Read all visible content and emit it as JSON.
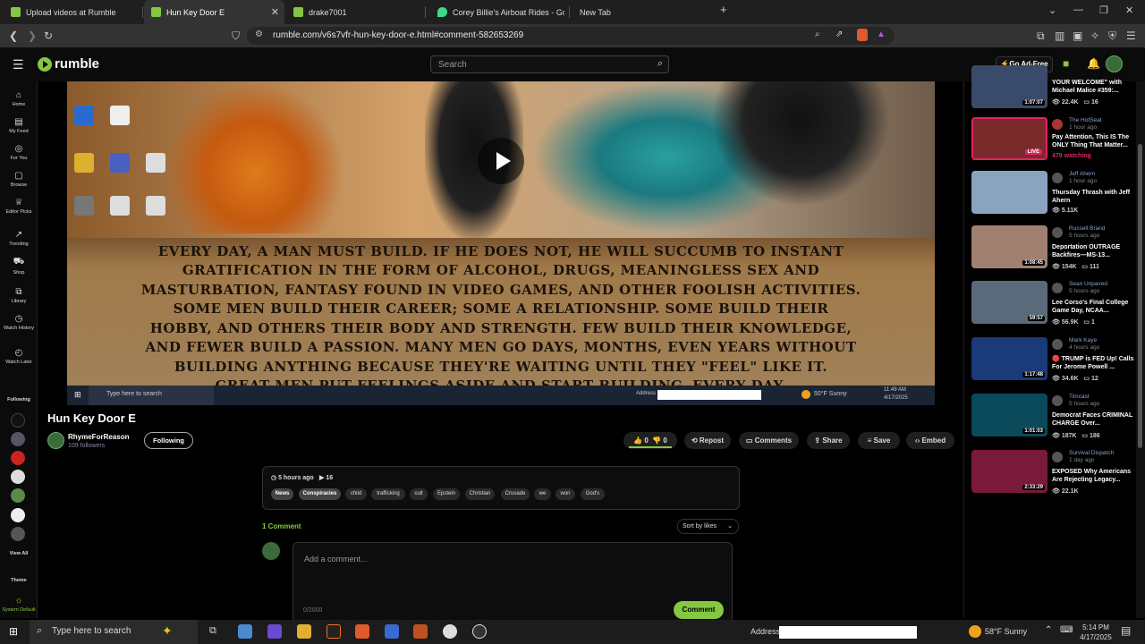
{
  "browser": {
    "tabs": [
      {
        "label": "Upload videos at Rumble",
        "color": "#85c742"
      },
      {
        "label": "Hun Key Door E",
        "color": "#85c742"
      },
      {
        "label": "drake7001",
        "color": "#85c742"
      },
      {
        "label": "Corey Billie's Airboat Rides - Googl",
        "color": "#3ddc84"
      },
      {
        "label": "New Tab",
        "color": ""
      }
    ],
    "url": "rumble.com/v6s7vfr-hun-key-door-e.html#comment-582653269"
  },
  "header": {
    "logo_text": "rumble",
    "search_placeholder": "Search",
    "go_ad_free": "Go Ad-Free"
  },
  "left_nav": {
    "items": [
      "Home",
      "My Feed",
      "For You",
      "Browse",
      "Editor Picks",
      "Trending",
      "Shop",
      "Library",
      "Watch History",
      "Watch Later"
    ],
    "following_label": "Following",
    "view_all": "View All",
    "theme_label": "Theme",
    "theme_value": "System Default"
  },
  "video": {
    "overlay_lines": [
      "EVERY DAY, A MAN MUST BUILD. IF HE DOES NOT, HE WILL SUCCUMB TO INSTANT",
      "GRATIFICATION IN THE FORM OF ALCOHOL, DRUGS, MEANINGLESS SEX AND",
      "MASTURBATION, FANTASY FOUND IN VIDEO GAMES, AND OTHER FOOLISH ACTIVITIES.",
      "SOME MEN BUILD THEIR CAREER; SOME A RELATIONSHIP. SOME BUILD THEIR",
      "HOBBY, AND OTHERS THEIR BODY AND STRENGTH. FEW BUILD THEIR KNOWLEDGE,",
      "AND FEWER BUILD A PASSION. MANY MEN GO DAYS, MONTHS, EVEN YEARS WITHOUT",
      "BUILDING ANYTHING BECAUSE THEY'RE WAITING UNTIL THEY \"FEEL\" LIKE IT.",
      "GREAT MEN PUT FEELINGS ASIDE AND START BUILDING. EVERY DAY."
    ],
    "inner_taskbar_search": "Type here to search",
    "inner_address_label": "Address",
    "inner_weather": "50°F  Sunny",
    "inner_time": "11:49 AM",
    "inner_date": "4/17/2025"
  },
  "details": {
    "title": "Hun Key Door E",
    "channel_name": "RhymeForReason",
    "followers": "109 followers",
    "following_btn": "Following",
    "likes": "0",
    "dislikes": "0",
    "repost": "Repost",
    "comments": "Comments",
    "share": "Share",
    "save": "Save",
    "embed": "Embed",
    "posted": "5 hours ago",
    "views": "16",
    "tags": [
      "News",
      "Conspiracies",
      "child",
      "trafficking",
      "cult",
      "Epstein",
      "Christian",
      "Crusade",
      "we",
      "won",
      "God's"
    ]
  },
  "comments": {
    "count_label": "1 Comment",
    "sort_label": "Sort by likes",
    "placeholder": "Add a comment...",
    "char_count": "0/2000",
    "submit": "Comment"
  },
  "sidebar": {
    "top_partial": {
      "title": "YOUR WELCOME\" with Michael Malice #359:...",
      "duration": "1:07:07",
      "views": "22.4K",
      "comments": "16"
    },
    "videos": [
      {
        "author": "The HotSeat",
        "time": "1 hour ago",
        "title": "Pay Attention, This IS The ONLY Thing That Matter...",
        "stats": "479 watching",
        "live": true,
        "thumb": "#7a2a2a"
      },
      {
        "author": "Jeff Ahern",
        "time": "1 hour ago",
        "title": "Thursday Thrash with Jeff Ahern",
        "stats": "5.11K",
        "comments": "",
        "duration": "",
        "thumb": "#8aa4c0"
      },
      {
        "author": "Russell Brand",
        "time": "5 hours ago",
        "title": "Deportation OUTRAGE Backfires—MS-13...",
        "stats": "154K",
        "comments": "111",
        "duration": "1:08:45",
        "thumb": "#a08070"
      },
      {
        "author": "Sean Unpaved",
        "time": "5 hours ago",
        "title": "Lee Corso's Final College Game Day, NCAA...",
        "stats": "56.9K",
        "comments": "1",
        "duration": "59:57",
        "thumb": "#5a6a7a"
      },
      {
        "author": "Mark Kaye",
        "time": "4 hours ago",
        "title": "🔴 TRUMP is FED Up! Calls For Jerome Powell ...",
        "stats": "34.6K",
        "comments": "12",
        "duration": "1:17:48",
        "thumb": "#1a3a7a"
      },
      {
        "author": "Timcast",
        "time": "5 hours ago",
        "title": "Democrat Faces CRIMINAL CHARGE Over...",
        "stats": "187K",
        "comments": "186",
        "duration": "1:01:03",
        "thumb": "#0a4a5a"
      },
      {
        "author": "Survival Dispatch",
        "time": "1 day ago",
        "title": "EXPOSED Why Americans Are Rejecting Legacy...",
        "stats": "22.1K",
        "comments": "",
        "duration": "2:33:29",
        "thumb": "#7a1a3a"
      }
    ]
  },
  "taskbar": {
    "search": "Type here to search",
    "address_label": "Address",
    "weather": "58°F  Sunny",
    "time": "5:14 PM",
    "date": "4/17/2025"
  }
}
